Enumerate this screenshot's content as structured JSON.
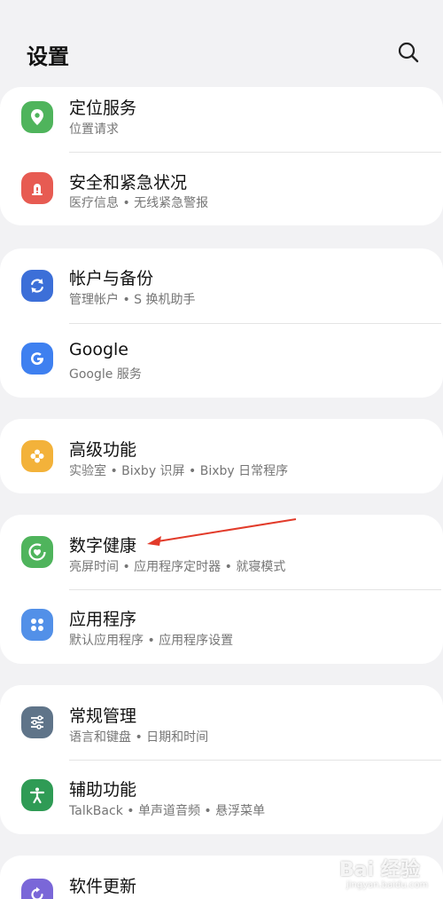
{
  "header": {
    "title": "设置",
    "search_icon": "search-icon"
  },
  "items": [
    {
      "key": "location",
      "title": "定位服务",
      "subtitle": "位置请求",
      "icon": "location-pin-icon",
      "color": "#4fb45c"
    },
    {
      "key": "safety",
      "title": "安全和紧急状况",
      "subtitle": "医疗信息 • 无线紧急警报",
      "icon": "alert-icon",
      "color": "#e75b52"
    },
    {
      "key": "accounts",
      "title": "帐户与备份",
      "subtitle": "管理帐户 • S 换机助手",
      "icon": "sync-icon",
      "color": "#3c6fd8"
    },
    {
      "key": "google",
      "title": "Google",
      "subtitle": "Google 服务",
      "icon": "google-icon",
      "color": "#3e80f0"
    },
    {
      "key": "advanced",
      "title": "高级功能",
      "subtitle": "实验室 • Bixby 识屏 • Bixby 日常程序",
      "icon": "puzzle-icon",
      "color": "#f3b23a"
    },
    {
      "key": "wellbeing",
      "title": "数字健康",
      "subtitle": "亮屏时间 • 应用程序定时器 • 就寝模式",
      "icon": "heart-ring-icon",
      "color": "#4fb45c"
    },
    {
      "key": "apps",
      "title": "应用程序",
      "subtitle": "默认应用程序 • 应用程序设置",
      "icon": "apps-grid-icon",
      "color": "#5290e8"
    },
    {
      "key": "general",
      "title": "常规管理",
      "subtitle": "语言和键盘 • 日期和时间",
      "icon": "sliders-icon",
      "color": "#5f7489"
    },
    {
      "key": "accessibility",
      "title": "辅助功能",
      "subtitle": "TalkBack • 单声道音频 • 悬浮菜单",
      "icon": "accessibility-icon",
      "color": "#2f9b55"
    },
    {
      "key": "update",
      "title": "软件更新",
      "subtitle": "",
      "icon": "update-icon",
      "color": "#7a67d8"
    }
  ],
  "annotation": {
    "arrow_color": "#e23b2a"
  },
  "watermark": {
    "main": "Bai 经验",
    "sub": "jingyan.baidu.com"
  }
}
